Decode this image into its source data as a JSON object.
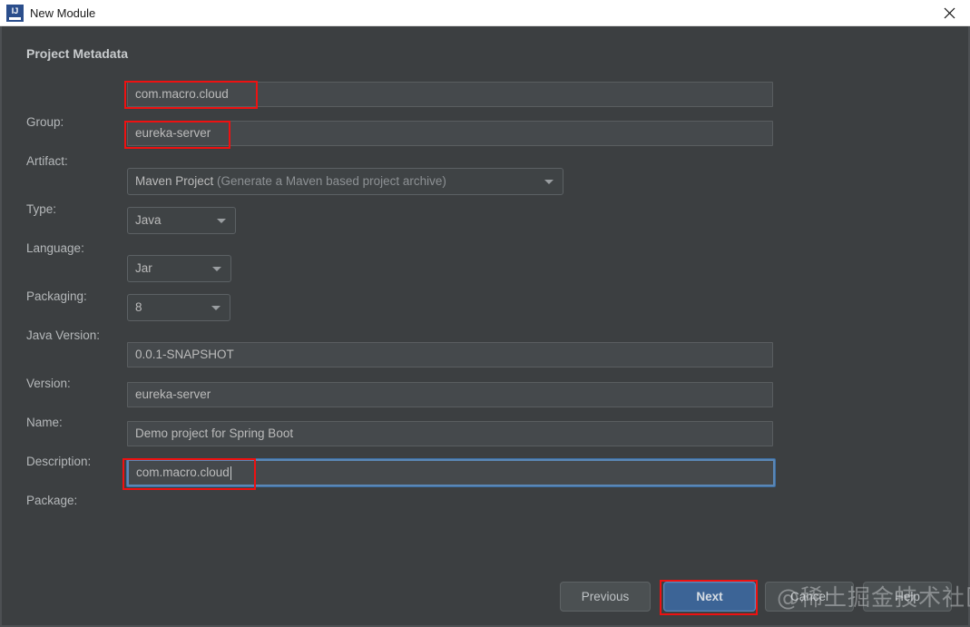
{
  "window": {
    "title": "New Module",
    "icon": "intellij-idea-icon",
    "icon_letters": "IJ",
    "close_label": "×"
  },
  "dialog": {
    "section_title": "Project Metadata"
  },
  "fields": {
    "group": {
      "label": "Group:",
      "value": "com.macro.cloud",
      "annotated": true
    },
    "artifact": {
      "label": "Artifact:",
      "value": "eureka-server",
      "annotated": true
    },
    "type": {
      "label": "Type:",
      "value": "Maven Project",
      "value_hint": " (Generate a Maven based project archive)"
    },
    "language": {
      "label": "Language:",
      "value": "Java"
    },
    "packaging": {
      "label": "Packaging:",
      "value": "Jar"
    },
    "java_version": {
      "label": "Java Version:",
      "value": "8"
    },
    "version": {
      "label": "Version:",
      "value": "0.0.1-SNAPSHOT"
    },
    "name": {
      "label": "Name:",
      "value": "eureka-server"
    },
    "description": {
      "label": "Description:",
      "value": "Demo project for Spring Boot"
    },
    "package": {
      "label": "Package:",
      "value": "com.macro.cloud",
      "annotated": true,
      "focused": true
    }
  },
  "buttons": {
    "previous": "Previous",
    "next": "Next",
    "cancel": "Cancel",
    "help": "Help"
  },
  "watermark": {
    "text": "@稀土掘金技术社区"
  },
  "colors": {
    "dialog_bg": "#3c3f41",
    "field_bg": "#45494c",
    "accent_blue": "#3c6496",
    "focus_blue": "#5b87b5",
    "annotation_red": "#ee1111",
    "text": "#bbbbbb"
  }
}
